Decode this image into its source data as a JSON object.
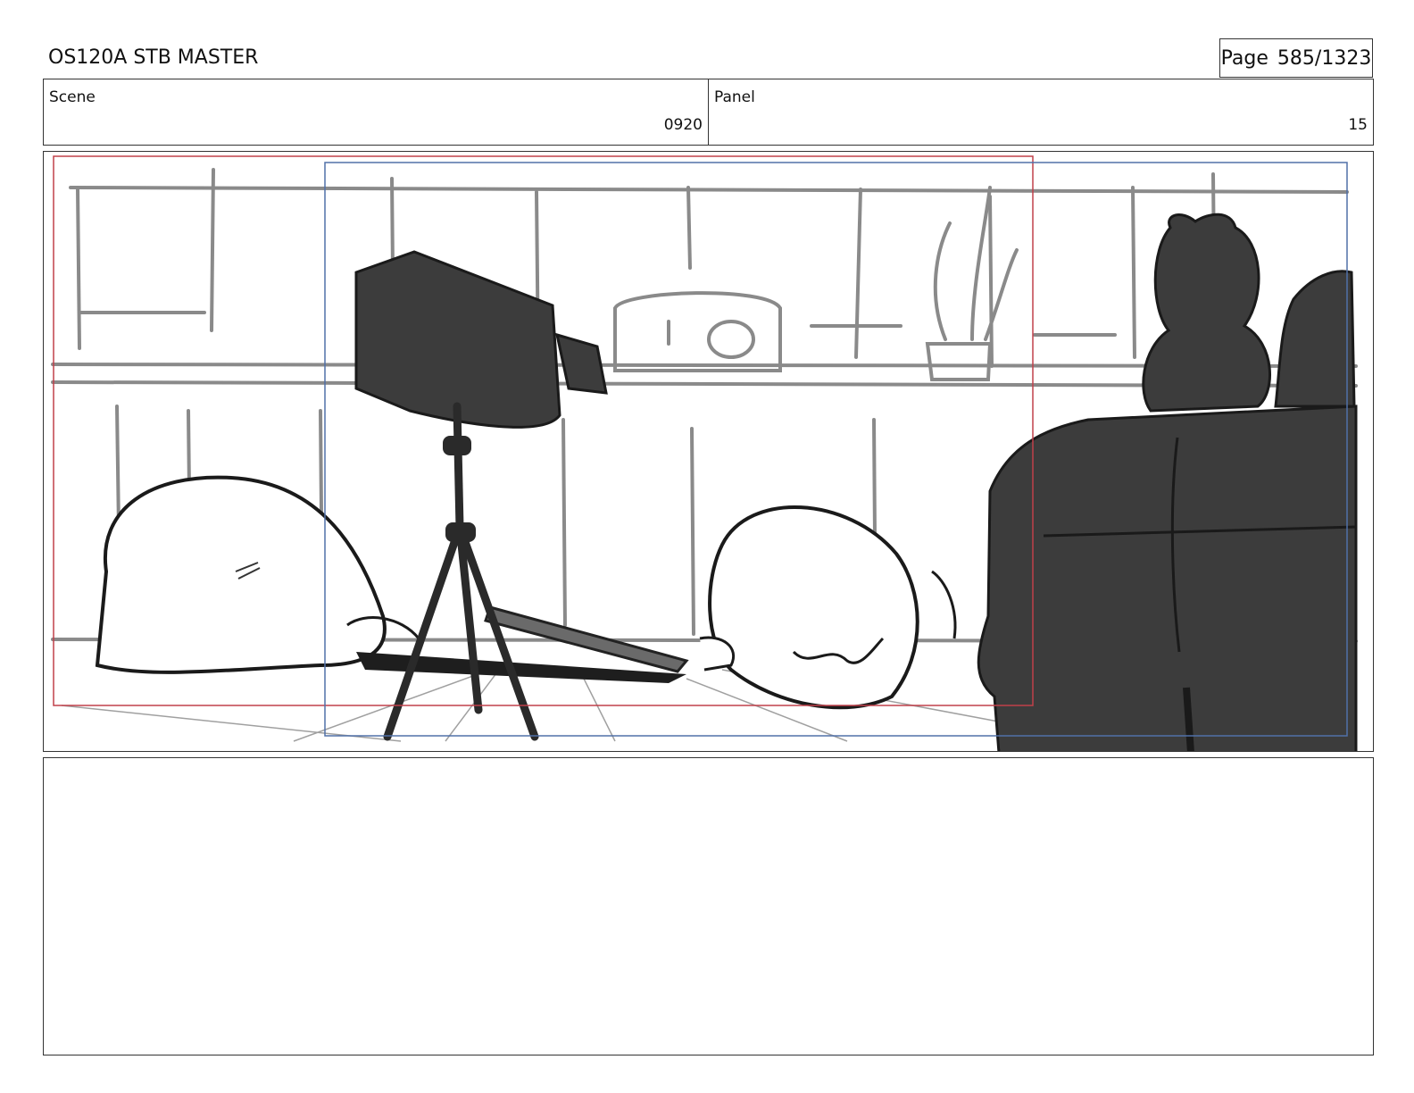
{
  "header": {
    "title": "OS120A STB MASTER",
    "page_label": "Page",
    "page_value": "585/1323"
  },
  "info": {
    "scene_label": "Scene",
    "scene_value": "0920",
    "panel_label": "Panel",
    "panel_value": "15"
  },
  "notes": {
    "text": ""
  },
  "colors": {
    "safe_frame_red": "#c0404a",
    "camera_frame_blue": "#5070a8",
    "ink_dark": "#3c3c3c"
  }
}
